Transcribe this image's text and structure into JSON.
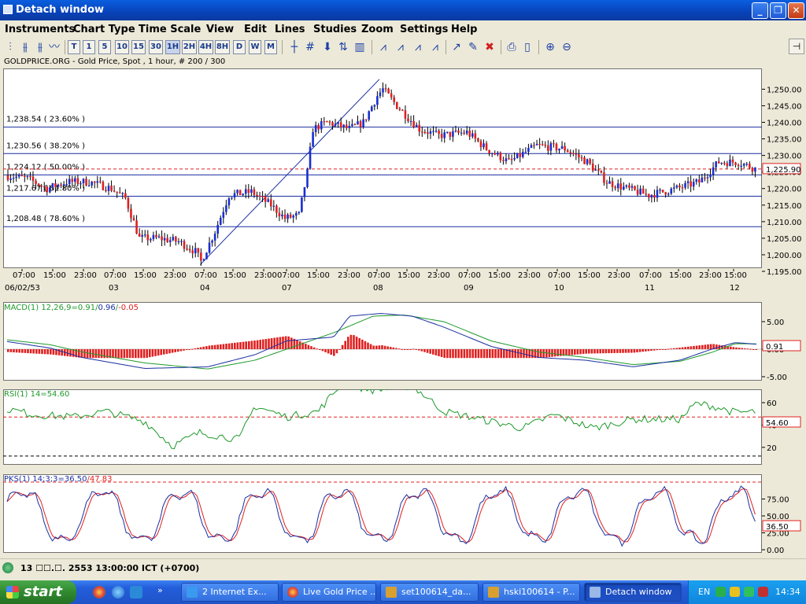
{
  "window": {
    "title": "Detach window"
  },
  "menu": [
    "Instruments",
    "Chart Type",
    "Time Scale",
    "View",
    "Edit",
    "Lines",
    "Studies",
    "Zoom",
    "Settings",
    "Help"
  ],
  "toolbar": {
    "timeframes": [
      "T",
      "1",
      "5",
      "10",
      "15",
      "30",
      "1H",
      "2H",
      "4H",
      "8H",
      "D",
      "W",
      "M"
    ],
    "active_timeframe": "1H"
  },
  "symbol_label": "GOLDPRICE.ORG - Gold Price, Spot , 1 hour, # 200 / 300",
  "price_axis": [
    "1,250.00",
    "1,245.00",
    "1,240.00",
    "1,235.00",
    "1,230.00",
    "1,225.00",
    "1,220.00",
    "1,215.00",
    "1,210.00",
    "1,205.00",
    "1,200.00",
    "1,195.00"
  ],
  "fib_levels": [
    {
      "label": "1,238.54 ( 23.60% )",
      "price": 1238.54
    },
    {
      "label": "1,230.56 ( 38.20% )",
      "price": 1230.56
    },
    {
      "label": "1,224.12 ( 50.00% )",
      "price": 1224.12
    },
    {
      "label": "1,217.67 ( 61.80% )",
      "price": 1217.67
    },
    {
      "label": "1,208.48 ( 78.60% )",
      "price": 1208.48
    }
  ],
  "last_price": "1,225.90",
  "time_axis": {
    "hours": [
      "07:00",
      "15:00",
      "23:00",
      "07:00",
      "15:00",
      "23:00",
      "07:00",
      "15:00",
      "23:00",
      "07:00",
      "15:00",
      "23:00",
      "07:00",
      "15:00",
      "23:00",
      "07:00",
      "15:00",
      "23:00",
      "07:00",
      "15:00",
      "23:00",
      "07:00",
      "15:00",
      "23:00",
      "15:00"
    ],
    "dates": [
      "06/02/53",
      "03",
      "04",
      "07",
      "08",
      "09",
      "10",
      "11",
      "12"
    ]
  },
  "macd": {
    "label": "MACD(1) 12,26,9=",
    "macd_value": "0.91",
    "signal_value": "0.96",
    "hist_value": "-0.05",
    "axis": [
      "5.00",
      "0.00",
      "-5.00"
    ],
    "last": "0.91"
  },
  "rsi": {
    "label": "RSI(1) 14=54.60",
    "axis": [
      "60",
      "40",
      "20"
    ],
    "last": "54.60"
  },
  "pks": {
    "label": "PKS(1) 14;3;3=",
    "k_value": "36.50",
    "d_value": "47.83",
    "axis": [
      "75.00",
      "50.00",
      "25.00",
      "0.00"
    ],
    "last": "36.50"
  },
  "status": {
    "text": "13 ☐☐.☐. 2553 13:00:00 ICT (+0700)"
  },
  "taskbar": {
    "start": "start",
    "tasks": [
      "2 Internet Ex...",
      "Live Gold Price ...",
      "set100614_da...",
      "hski100614 - P...",
      "Detach window"
    ],
    "lang": "EN",
    "clock": "14:34"
  },
  "colors": {
    "bull": "#1a2fd0",
    "bear": "#e02020",
    "macd_line": "#1a2fa0",
    "signal_line": "#1e9a2a",
    "fib": "#1a2fa0"
  }
}
